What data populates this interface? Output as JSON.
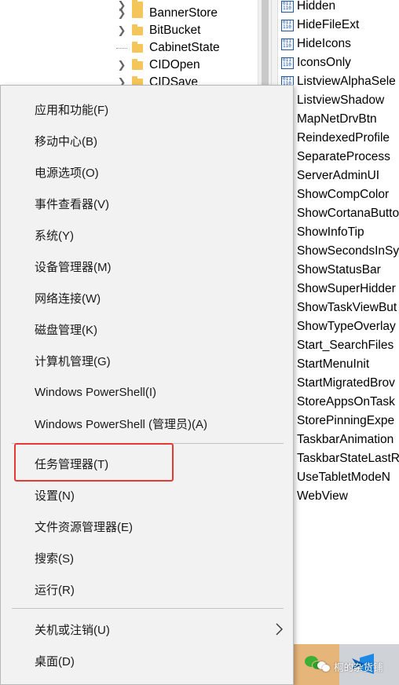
{
  "registry_tree": {
    "items": [
      {
        "label": "BannerStore",
        "expandable": true
      },
      {
        "label": "BitBucket",
        "expandable": true
      },
      {
        "label": "CabinetState",
        "expandable": false
      },
      {
        "label": "CIDOpen",
        "expandable": true
      },
      {
        "label": "CIDSave",
        "expandable": true
      }
    ]
  },
  "registry_values": {
    "items": [
      "Hidden",
      "HideFileExt",
      "HideIcons",
      "IconsOnly",
      "ListviewAlphaSele",
      "ListviewShadow",
      "MapNetDrvBtn",
      "ReindexedProfile",
      "SeparateProcess",
      "ServerAdminUI",
      "ShowCompColor",
      "ShowCortanaButto",
      "ShowInfoTip",
      "ShowSecondsInSy",
      "ShowStatusBar",
      "ShowSuperHidder",
      "ShowTaskViewBut",
      "ShowTypeOverlay",
      "Start_SearchFiles",
      "StartMenuInit",
      "StartMigratedBrov",
      "StoreAppsOnTask",
      "StorePinningExpe",
      "TaskbarAnimation",
      "TaskbarStateLastR",
      "UseTabletModeN",
      "WebView"
    ]
  },
  "context_menu": {
    "items": [
      "应用和功能(F)",
      "移动中心(B)",
      "电源选项(O)",
      "事件查看器(V)",
      "系统(Y)",
      "设备管理器(M)",
      "网络连接(W)",
      "磁盘管理(K)",
      "计算机管理(G)",
      "Windows PowerShell(I)",
      "Windows PowerShell (管理员)(A)",
      "任务管理器(T)",
      "设置(N)",
      "文件资源管理器(E)",
      "搜索(S)",
      "运行(R)",
      "关机或注销(U)",
      "桌面(D)"
    ],
    "highlighted_item": "任务管理器(T)",
    "highlight_color": "#e53935"
  },
  "taskbar": {
    "icons": [
      "wechat-icon",
      "vscode-icon"
    ]
  },
  "watermark": {
    "text": "桐的杂货铺"
  }
}
